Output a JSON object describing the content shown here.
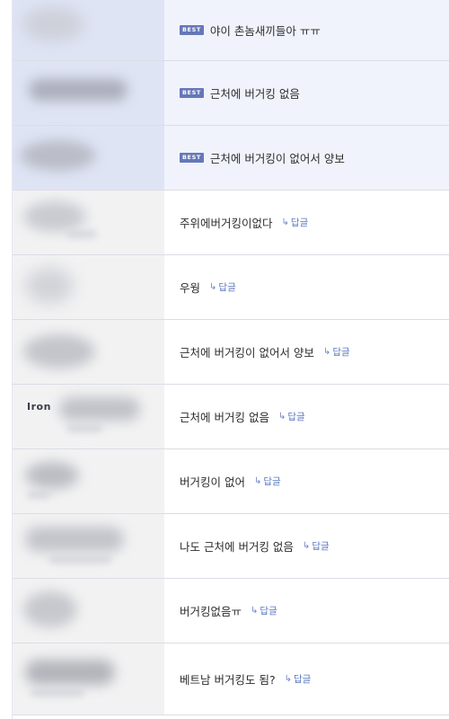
{
  "comments": [
    {
      "best": true,
      "badge": "BEST",
      "text": "야이 촌놈새끼들아 ㅠㅠ",
      "reply_label": null,
      "author_partial": null
    },
    {
      "best": true,
      "badge": "BEST",
      "text": "근처에 버거킹 없음",
      "reply_label": null,
      "author_partial": null
    },
    {
      "best": true,
      "badge": "BEST",
      "text": "근처에 버거킹이 없어서 양보",
      "reply_label": null,
      "author_partial": null
    },
    {
      "best": false,
      "badge": null,
      "text": "주위에버거킹이없다",
      "reply_label": "답글",
      "author_partial": null
    },
    {
      "best": false,
      "badge": null,
      "text": "우웡",
      "reply_label": "답글",
      "author_partial": null
    },
    {
      "best": false,
      "badge": null,
      "text": "근처에 버거킹이 없어서 양보",
      "reply_label": "답글",
      "author_partial": null
    },
    {
      "best": false,
      "badge": null,
      "text": "근처에 버거킹 없음",
      "reply_label": "답글",
      "author_partial": "Iron"
    },
    {
      "best": false,
      "badge": null,
      "text": "버거킹이 없어",
      "reply_label": "답글",
      "author_partial": null
    },
    {
      "best": false,
      "badge": null,
      "text": "나도 근처에 버거킹 없음",
      "reply_label": "답글",
      "author_partial": null
    },
    {
      "best": false,
      "badge": null,
      "text": "버거킹없음ㅠ",
      "reply_label": "답글",
      "author_partial": null
    },
    {
      "best": false,
      "badge": null,
      "text": "베트남 버거킹도 됨?",
      "reply_label": "답글",
      "author_partial": null
    }
  ],
  "colors": {
    "best_row_bg": "#f1f3fc",
    "best_author_bg": "#dfe4f5",
    "badge_bg": "#6677b9",
    "reply_link": "#5b77c4"
  },
  "icons": {
    "reply": "reply-arrow-icon"
  }
}
